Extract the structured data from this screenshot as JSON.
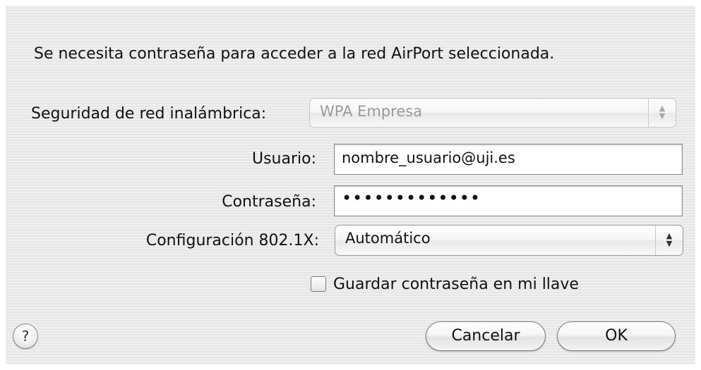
{
  "dialog": {
    "message": "Se necesita contraseña para acceder a la red AirPort seleccionada."
  },
  "security": {
    "label": "Seguridad de red inalámbrica:",
    "value": "WPA Empresa",
    "enabled": false
  },
  "user": {
    "label": "Usuario:",
    "value": "nombre_usuario@uji.es"
  },
  "password": {
    "label": "Contraseña:",
    "masked_value": "•••••••••••••"
  },
  "config": {
    "label": "Configuración 802.1X:",
    "value": "Automático"
  },
  "keychain": {
    "label": "Guardar contraseña en mi llave",
    "checked": false
  },
  "buttons": {
    "help": "?",
    "cancel": "Cancelar",
    "ok": "OK"
  },
  "icons": {
    "popup_arrows": "up-down-arrows-icon",
    "help": "question-mark-icon"
  },
  "colors": {
    "background": "#ececec",
    "text": "#111111",
    "disabled_text": "#9a9a9a"
  }
}
